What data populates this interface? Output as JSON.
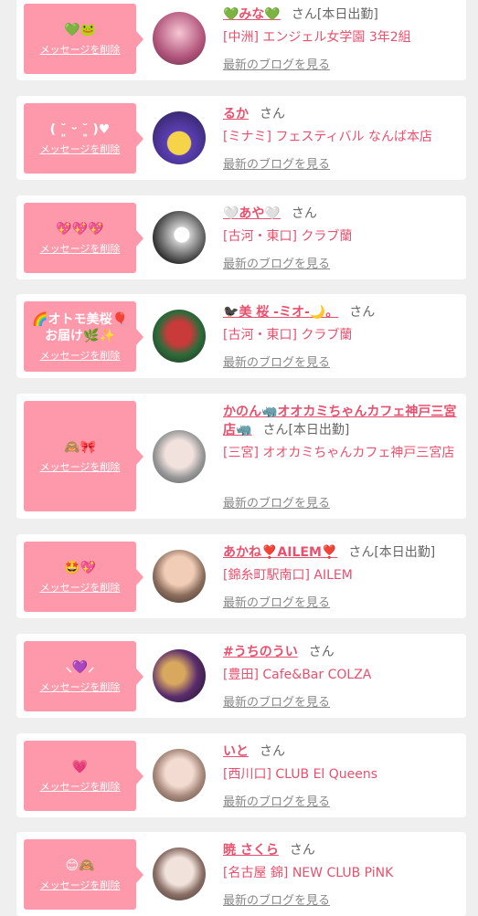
{
  "delete_label": "メッセージを削除",
  "san_label": "さん",
  "blog_label": "最新のブログを見る",
  "cards": [
    {
      "message": "💚🐸",
      "name": "💚みな💚",
      "today": "[本日出勤]",
      "area": "[中洲]",
      "shop": "エンジェル女学園 3年2組"
    },
    {
      "message": "( ˘͈ ᵕ ˘͈ )♥",
      "name": "るか",
      "today": "",
      "area": "[ミナミ]",
      "shop": "フェスティバル なんば本店"
    },
    {
      "message": "💖💖💖",
      "name": "🤍あや🤍",
      "today": "",
      "area": "[古河・東口]",
      "shop": "クラブ蘭"
    },
    {
      "message": "🌈オトモ美桜🎈\nお届け🌿✨",
      "name": "🐦‍⬛美 桜 -ミオ-🌙。",
      "today": "",
      "area": "[古河・東口]",
      "shop": "クラブ蘭"
    },
    {
      "message": "🙈🎀",
      "name": "かのん🦏オオカミちゃんカフェ神戸三宮店🦏",
      "today": "[本日出勤]",
      "area": "[三宮]",
      "shop": "オオカミちゃんカフェ神戸三宮店"
    },
    {
      "message": "🤩💖",
      "name": "あかね❣️AILEM❣️",
      "today": "[本日出勤]",
      "area": "[錦糸町駅南口]",
      "shop": "AILEM"
    },
    {
      "message": "⸜💜⸝",
      "name": "#うちのうい",
      "today": "",
      "area": "[豊田]",
      "shop": "Cafe&Bar COLZA"
    },
    {
      "message": "💗",
      "name": "いと",
      "today": "",
      "area": "[西川口]",
      "shop": "CLUB El Queens"
    },
    {
      "message": "😊🙈",
      "name": "暁 さくら",
      "today": "",
      "area": "[名古屋 錦]",
      "shop": "NEW CLUB PiNK"
    }
  ]
}
